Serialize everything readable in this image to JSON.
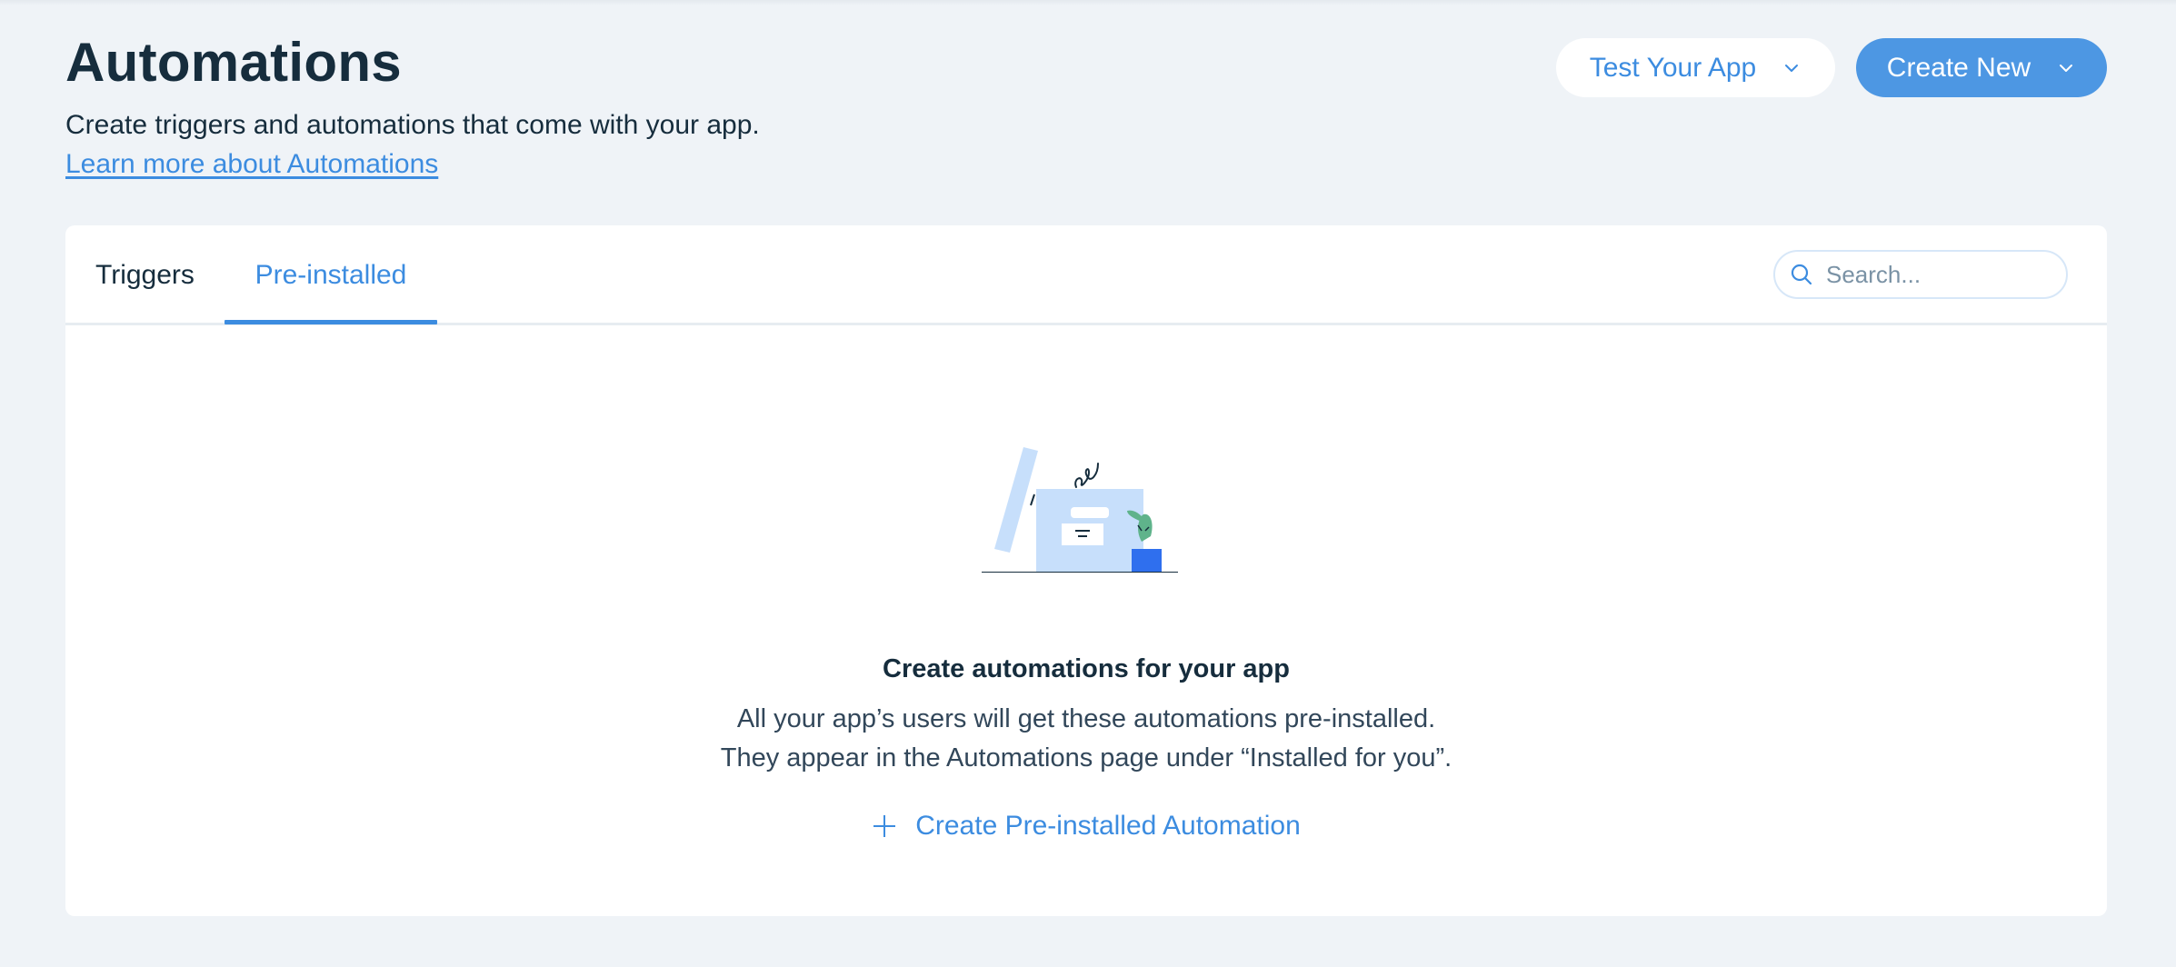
{
  "header": {
    "title": "Automations",
    "subtitle": "Create triggers and automations that come with your app.",
    "learn_link": "Learn more about Automations"
  },
  "actions": {
    "test_app_label": "Test Your App",
    "create_new_label": "Create New"
  },
  "tabs": [
    {
      "label": "Triggers",
      "active": false
    },
    {
      "label": "Pre-installed",
      "active": true
    }
  ],
  "search": {
    "placeholder": "Search...",
    "value": ""
  },
  "empty_state": {
    "title": "Create automations for your app",
    "line1": "All your app’s users will get these automations pre-installed.",
    "line2": "They appear in the Automations page under “Installed for you”.",
    "cta": "Create Pre-installed Automation"
  },
  "colors": {
    "accent": "#3c8ce0",
    "primary_button": "#4d97e3",
    "background": "#eff3f7",
    "text": "#162d3d"
  },
  "icons": [
    "chevron-down-icon",
    "search-icon",
    "plus-icon",
    "empty-state-illustration"
  ]
}
